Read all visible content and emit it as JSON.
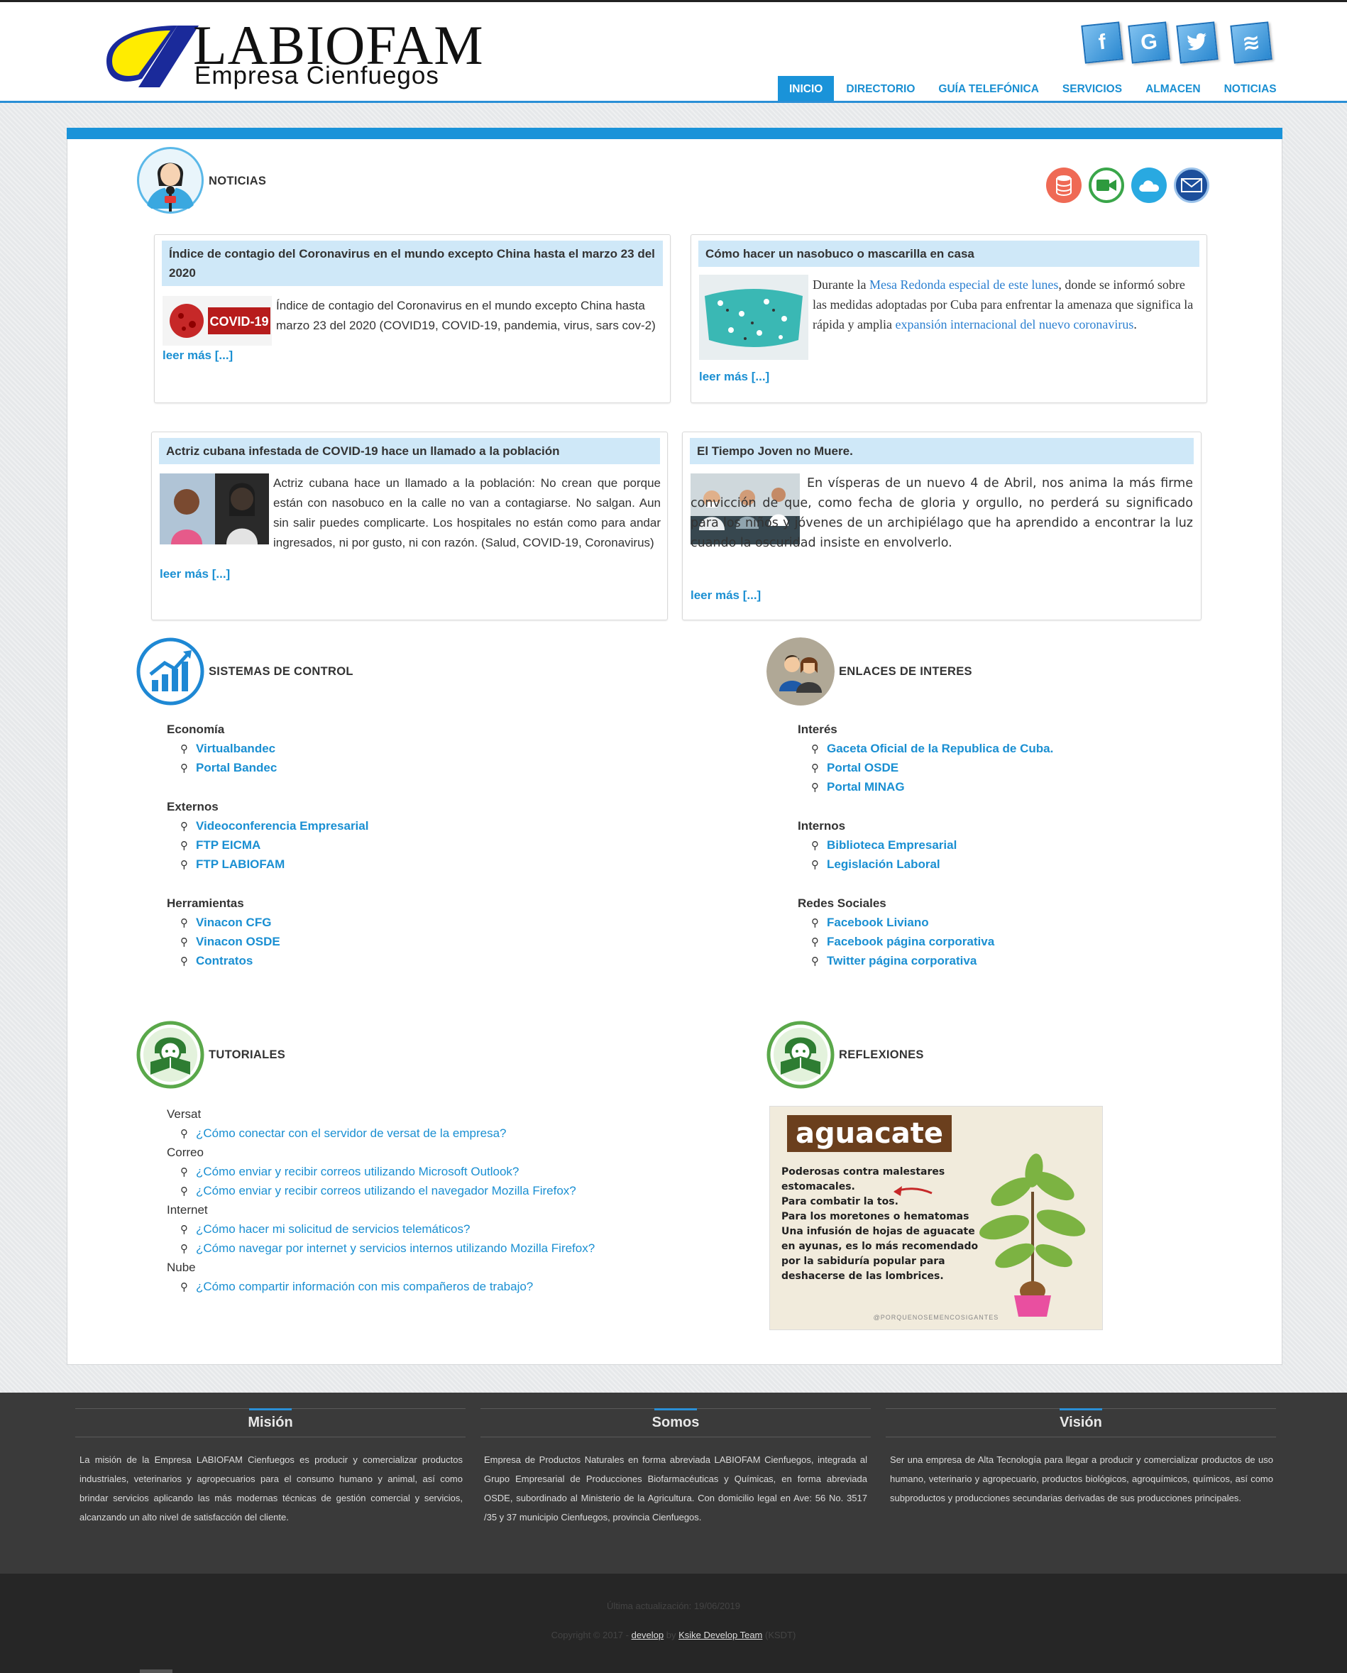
{
  "header": {
    "logo_title": "LABIOFAM",
    "logo_subtitle": "Empresa Cienfuegos",
    "social": [
      {
        "icon": "facebook-icon",
        "glyph": "f"
      },
      {
        "icon": "google-icon",
        "glyph": "G"
      },
      {
        "icon": "twitter-icon",
        "glyph": "t"
      },
      {
        "icon": "rss-icon",
        "glyph": "≋"
      }
    ],
    "nav": [
      "INICIO",
      "DIRECTORIO",
      "GUÍA TELEFÓNICA",
      "SERVICIOS",
      "ALMACEN",
      "NOTICIAS"
    ],
    "nav_active": "INICIO"
  },
  "noticias": {
    "title": "NOTICIAS",
    "quick_icons": [
      "database-icon",
      "video-camera-icon",
      "cloud-icon",
      "mail-icon"
    ],
    "cards": [
      {
        "title": "Índice de contagio del Coronavirus en el mundo excepto China hasta el marzo 23 del 2020",
        "text": "Índice de contagio del Coronavirus en el mundo excepto China hasta marzo 23 del 2020 (COVID19, COVID-19, pandemia, virus, sars cov-2)",
        "image_label": "COVID-19",
        "more": "leer más [...]"
      },
      {
        "title": "Cómo hacer un nasobuco o mascarilla en casa",
        "text_parts": [
          "Durante la ",
          "Mesa Redonda especial de este lunes",
          ", donde se informó sobre las medidas adoptadas por Cuba para enfrentar la amenaza que significa la rápida y amplia ",
          "expansión internacional del nuevo coronavirus",
          "."
        ],
        "more": "leer más [...]"
      },
      {
        "title": "Actriz cubana infestada de COVID-19 hace un llamado a la población",
        "text": "Actriz cubana hace un llamado a la población: No crean que porque están con nasobuco en la calle no van a contagiarse.  No salgan. Aun sin salir puedes complicarte. Los hospitales no están como para andar ingresados, ni por gusto, ni con razón. (Salud, COVID-19, Coronavirus)",
        "more": "leer más [...]"
      },
      {
        "title": "El Tiempo Joven no Muere.",
        "text": "En vísperas de un nuevo 4 de Abril, nos anima la más firme convicción de que, como fecha de gloria y orgullo, no perderá su significado para los niños y jóvenes de un archipiélago que ha aprendido a encontrar la luz cuando la oscuridad insiste en envolverlo.",
        "more": "leer más [...]"
      }
    ]
  },
  "sistemas": {
    "title": "SISTEMAS DE CONTROL",
    "groups": [
      {
        "label": "Economía",
        "links": [
          "Virtualbandec",
          "Portal Bandec"
        ]
      },
      {
        "label": "Externos",
        "links": [
          "Videoconferencia Empresarial",
          "FTP EICMA",
          "FTP LABIOFAM"
        ]
      },
      {
        "label": "Herramientas",
        "links": [
          "Vinacon CFG",
          "Vinacon OSDE",
          "Contratos"
        ]
      }
    ]
  },
  "enlaces": {
    "title": "ENLACES DE INTERES",
    "groups": [
      {
        "label": "Interés",
        "links": [
          "Gaceta Oficial de la Republica de Cuba.",
          "Portal OSDE",
          "Portal MINAG"
        ]
      },
      {
        "label": "Internos",
        "links": [
          "Biblioteca Empresarial",
          "Legislación Laboral"
        ]
      },
      {
        "label": "Redes Sociales",
        "links": [
          "Facebook Liviano",
          "Facebook página corporativa",
          "Twitter página corporativa"
        ]
      }
    ]
  },
  "tutoriales": {
    "title": "TUTORIALES",
    "groups": [
      {
        "label": "Versat",
        "links": [
          "¿Cómo conectar con el servidor de versat de la empresa?"
        ]
      },
      {
        "label": "Correo",
        "links": [
          "¿Cómo enviar y recibir correos utilizando Microsoft Outlook?",
          "¿Cómo enviar y recibir correos utilizando el navegador Mozilla Firefox?"
        ]
      },
      {
        "label": "Internet",
        "links": [
          "¿Cómo hacer mi solicitud de servicios telemáticos?",
          "¿Cómo navegar por internet y servicios internos utilizando Mozilla Firefox?"
        ]
      },
      {
        "label": "Nube",
        "links": [
          "¿Cómo compartir información con mis compañeros de trabajo?"
        ]
      }
    ]
  },
  "reflexiones": {
    "title": "REFLEXIONES",
    "poster_heading": "aguacate",
    "poster_lines": [
      "Poderosas contra malestares",
      "estomacales.",
      "Para combatir la tos.",
      "Para los moretones o hematomas",
      "Una infusión de hojas de aguacate",
      "en ayunas, es lo más recomendado",
      "por la sabiduría popular para",
      "deshacerse de las lombrices."
    ],
    "poster_credit": "@PORQUENOSEMENCOSIGANTES"
  },
  "footer": {
    "columns": [
      {
        "title": "Misión",
        "text": "La misión de la Empresa LABIOFAM Cienfuegos es producir y comercializar productos industriales, veterinarios y agropecuarios para el consumo humano y animal, así como brindar servicios aplicando las más modernas técnicas de gestión comercial y servicios, alcanzando un alto nivel de satisfacción del cliente."
      },
      {
        "title": "Somos",
        "text": "Empresa de Productos Naturales en forma abreviada LABIOFAM Cienfuegos, integrada al Grupo Empresarial de Producciones Biofarmacéuticas y Químicas, en forma abreviada OSDE, subordinado al Ministerio de la Agricultura. Con domicilio legal en Ave: 56 No. 3517 /35 y 37 municipio Cienfuegos, provincia Cienfuegos."
      },
      {
        "title": "Visión",
        "text": "Ser una empresa de Alta Tecnología para llegar a producir y comercializar productos de uso humano, veterinario y agropecuario, productos biológicos, agroquímicos, químicos, así como subproductos y producciones secundarias derivadas de sus producciones principales."
      }
    ],
    "last_update": "Última actualización: 19/06/2019",
    "copyright_prefix": "Copyright © 2017 - ",
    "develop_link": "develop",
    "by": " by ",
    "team_link": "Ksike Develop Team",
    "team_suffix": " (KSDT)"
  },
  "colors": {
    "accent": "#1a93d9",
    "footer": "#3a3a3a",
    "card_head": "#cfe8f8"
  }
}
